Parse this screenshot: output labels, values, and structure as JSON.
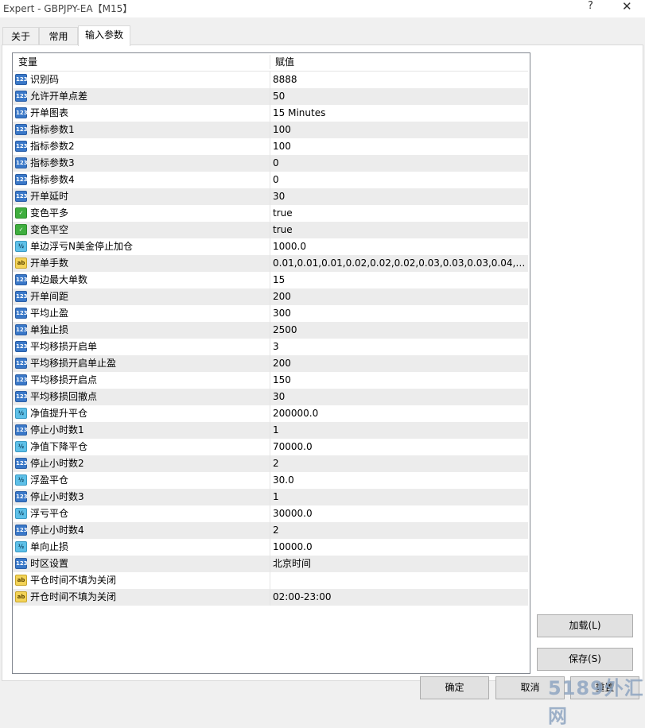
{
  "window": {
    "title": "Expert - GBPJPY-EA【M15】",
    "help": "?",
    "close": "✕"
  },
  "tabs": [
    {
      "label": "关于"
    },
    {
      "label": "常用"
    },
    {
      "label": "输入参数"
    }
  ],
  "grid": {
    "columns": [
      "变量",
      "赋值"
    ],
    "rows": [
      {
        "icon": "int",
        "name": "识别码",
        "value": "8888"
      },
      {
        "icon": "int",
        "name": "允许开单点差",
        "value": "50"
      },
      {
        "icon": "int",
        "name": "开单图表",
        "value": "15 Minutes"
      },
      {
        "icon": "int",
        "name": "指标参数1",
        "value": "100"
      },
      {
        "icon": "int",
        "name": "指标参数2",
        "value": "100"
      },
      {
        "icon": "int",
        "name": "指标参数3",
        "value": "0"
      },
      {
        "icon": "int",
        "name": "指标参数4",
        "value": "0"
      },
      {
        "icon": "int",
        "name": "开单延时",
        "value": "30"
      },
      {
        "icon": "bool",
        "name": "变色平多",
        "value": "true"
      },
      {
        "icon": "bool",
        "name": "变色平空",
        "value": "true"
      },
      {
        "icon": "dbl",
        "name": "单边浮亏N美金停止加仓",
        "value": "1000.0"
      },
      {
        "icon": "str",
        "name": "开单手数",
        "value": "0.01,0.01,0.01,0.02,0.02,0.02,0.03,0.03,0.03,0.04,0.04,0...."
      },
      {
        "icon": "int",
        "name": "单边最大单数",
        "value": "15"
      },
      {
        "icon": "int",
        "name": "开单间距",
        "value": "200"
      },
      {
        "icon": "int",
        "name": "平均止盈",
        "value": "300"
      },
      {
        "icon": "int",
        "name": "单独止损",
        "value": "2500"
      },
      {
        "icon": "int",
        "name": "平均移损开启单",
        "value": "3"
      },
      {
        "icon": "int",
        "name": "平均移损开启单止盈",
        "value": "200"
      },
      {
        "icon": "int",
        "name": "平均移损开启点",
        "value": "150"
      },
      {
        "icon": "int",
        "name": "平均移损回撤点",
        "value": "30"
      },
      {
        "icon": "dbl",
        "name": "净值提升平仓",
        "value": "200000.0"
      },
      {
        "icon": "int",
        "name": "停止小时数1",
        "value": "1"
      },
      {
        "icon": "dbl",
        "name": "净值下降平仓",
        "value": "70000.0"
      },
      {
        "icon": "int",
        "name": "停止小时数2",
        "value": "2"
      },
      {
        "icon": "dbl",
        "name": "浮盈平仓",
        "value": "30.0"
      },
      {
        "icon": "int",
        "name": "停止小时数3",
        "value": "1"
      },
      {
        "icon": "dbl",
        "name": "浮亏平仓",
        "value": "30000.0"
      },
      {
        "icon": "int",
        "name": "停止小时数4",
        "value": "2"
      },
      {
        "icon": "dbl",
        "name": "单向止损",
        "value": "10000.0"
      },
      {
        "icon": "int",
        "name": "时区设置",
        "value": "北京时间"
      },
      {
        "icon": "str",
        "name": "平仓时间不填为关闭",
        "value": ""
      },
      {
        "icon": "str",
        "name": "开仓时间不填为关闭",
        "value": "02:00-23:00"
      }
    ]
  },
  "icons": {
    "int": "123",
    "bool": "✓",
    "dbl": "½",
    "str": "ab"
  },
  "buttons": {
    "load": "加载(L)",
    "save": "保存(S)",
    "ok": "确定",
    "cancel": "取消",
    "reset": "重置"
  },
  "watermark": "5189外汇网"
}
